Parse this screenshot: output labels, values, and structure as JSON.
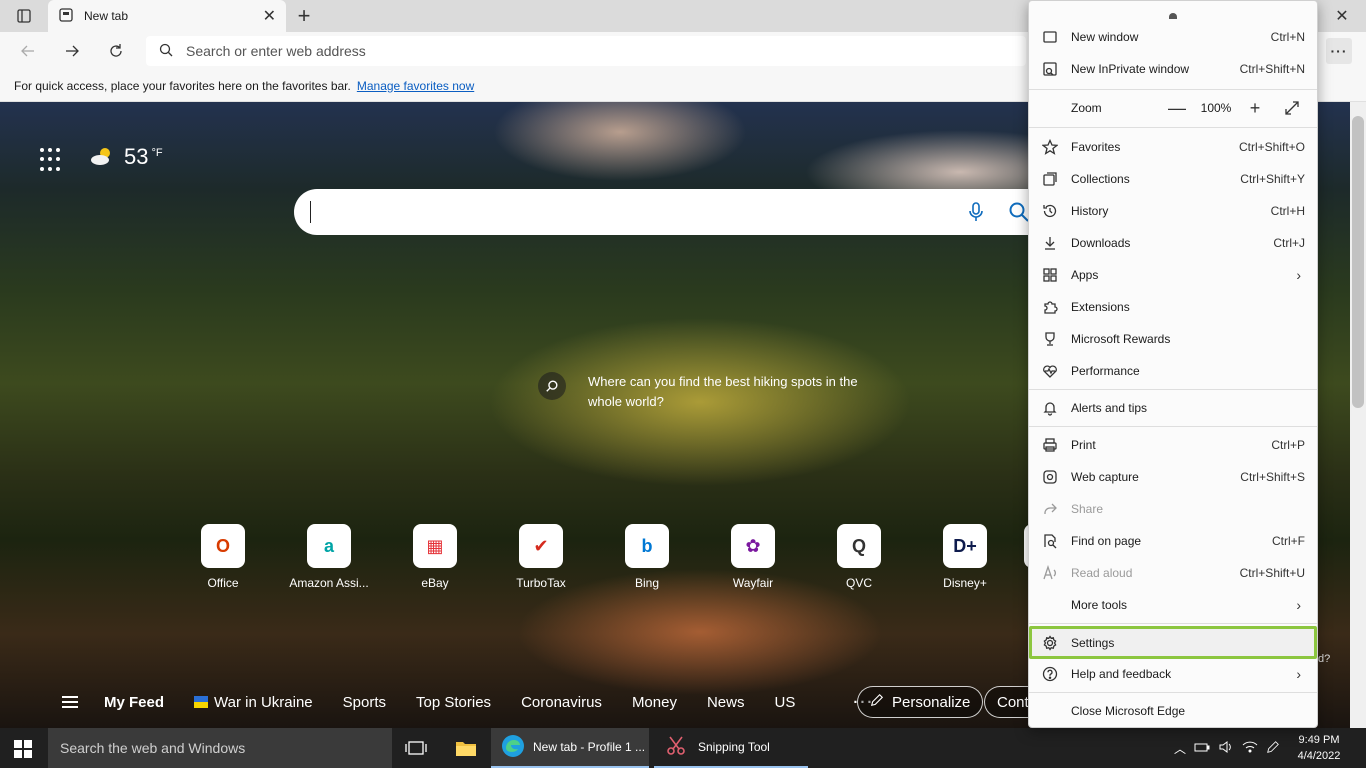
{
  "browser": {
    "tab_title": "New tab",
    "address_placeholder": "Search or enter web address",
    "favbar_text": "For quick access, place your favorites here on the favorites bar.",
    "favbar_link": "Manage favorites now"
  },
  "newtab": {
    "temperature": "53",
    "temp_unit": "°F",
    "hint_text": "Where can you find the best hiking spots in the whole world?",
    "quick_links": [
      {
        "label": "Office",
        "color": "#d83b01",
        "glyph": "O"
      },
      {
        "label": "Amazon Assi...",
        "color": "#00a4a6",
        "glyph": "a"
      },
      {
        "label": "eBay",
        "color": "#e53238",
        "glyph": "▦"
      },
      {
        "label": "TurboTax",
        "color": "#d52b1e",
        "glyph": "✔"
      },
      {
        "label": "Bing",
        "color": "#0078d4",
        "glyph": "b"
      },
      {
        "label": "Wayfair",
        "color": "#7b189f",
        "glyph": "✿"
      },
      {
        "label": "QVC",
        "color": "#333333",
        "glyph": "Q"
      },
      {
        "label": "Disney+",
        "color": "#0e1b4d",
        "glyph": "D+"
      }
    ],
    "feed": {
      "items": [
        "My Feed",
        "War in Ukraine",
        "Sports",
        "Top Stories",
        "Coronavirus",
        "Money",
        "News",
        "US"
      ],
      "more": "···",
      "personalize": "Personalize",
      "content_partial": "Conte",
      "partial_hint": "d?"
    }
  },
  "menu": {
    "items": [
      {
        "label": "New window",
        "shortcut": "Ctrl+N",
        "icon": "window-icon"
      },
      {
        "label": "New InPrivate window",
        "shortcut": "Ctrl+Shift+N",
        "icon": "inprivate-icon"
      },
      {
        "label": "Zoom",
        "icon": "zoom-icon"
      },
      {
        "label": "Favorites",
        "shortcut": "Ctrl+Shift+O",
        "icon": "star-icon"
      },
      {
        "label": "Collections",
        "shortcut": "Ctrl+Shift+Y",
        "icon": "collections-icon"
      },
      {
        "label": "History",
        "shortcut": "Ctrl+H",
        "icon": "history-icon"
      },
      {
        "label": "Downloads",
        "shortcut": "Ctrl+J",
        "icon": "download-icon"
      },
      {
        "label": "Apps",
        "icon": "apps-icon"
      },
      {
        "label": "Extensions",
        "icon": "puzzle-icon"
      },
      {
        "label": "Microsoft Rewards",
        "icon": "trophy-icon"
      },
      {
        "label": "Performance",
        "icon": "heart-pulse-icon"
      },
      {
        "label": "Alerts and tips",
        "icon": "bell-icon"
      },
      {
        "label": "Print",
        "shortcut": "Ctrl+P",
        "icon": "printer-icon"
      },
      {
        "label": "Web capture",
        "shortcut": "Ctrl+Shift+S",
        "icon": "capture-icon"
      },
      {
        "label": "Share",
        "icon": "share-icon"
      },
      {
        "label": "Find on page",
        "shortcut": "Ctrl+F",
        "icon": "find-icon"
      },
      {
        "label": "Read aloud",
        "shortcut": "Ctrl+Shift+U",
        "icon": "read-aloud-icon"
      },
      {
        "label": "More tools",
        "icon": "tools-icon"
      },
      {
        "label": "Settings",
        "icon": "gear-icon"
      },
      {
        "label": "Help and feedback",
        "icon": "help-icon"
      },
      {
        "label": "Close Microsoft Edge",
        "icon": "none"
      }
    ],
    "zoom": {
      "minus": "—",
      "value": "100%",
      "plus": "+"
    },
    "highlight_color": "#8cc63f"
  },
  "taskbar": {
    "search_placeholder": "Search the web and Windows",
    "apps": [
      {
        "label": "New tab - Profile 1 ..."
      },
      {
        "label": "Snipping Tool"
      }
    ],
    "time": "9:49 PM",
    "date": "4/4/2022"
  }
}
